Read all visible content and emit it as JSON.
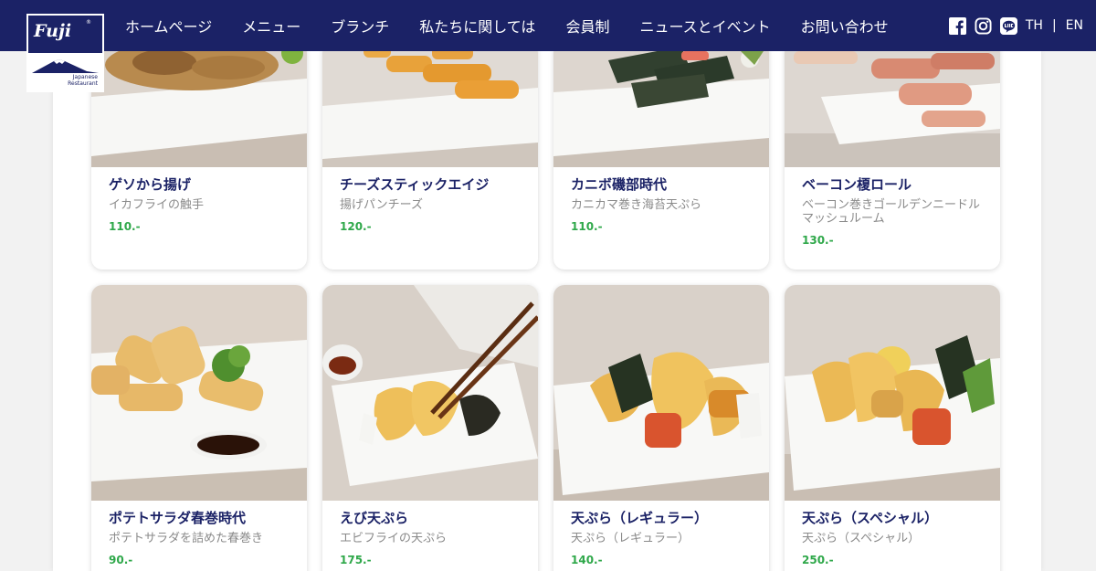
{
  "brand": {
    "logo_text": "Fuji",
    "logo_sub": "Japanese Restaurant",
    "navy": "#1b2266",
    "price_color": "#2fa84a"
  },
  "nav": {
    "items": [
      "ホームページ",
      "メニュー",
      "ブランチ",
      "私たちに関しては",
      "会員制",
      "ニュースとイベント",
      "お問い合わせ"
    ],
    "social": [
      "facebook-icon",
      "instagram-icon",
      "line-icon"
    ],
    "lang_th": "TH",
    "lang_sep": "|",
    "lang_en": "EN"
  },
  "menu": {
    "items": [
      {
        "title": "ゲソから揚げ",
        "desc": "イカフライの触手",
        "price": "110.-"
      },
      {
        "title": "チーズスティックエイジ",
        "desc": "揚げパンチーズ",
        "price": "120.-"
      },
      {
        "title": "カニボ磯部時代",
        "desc": "カニカマ巻き海苔天ぷら",
        "price": "110.-"
      },
      {
        "title": "ベーコン榎ロール",
        "desc": "ベーコン巻きゴールデンニードルマッシュルーム",
        "price": "130.-"
      },
      {
        "title": "ポテトサラダ春巻時代",
        "desc": "ポテトサラダを詰めた春巻き",
        "price": "90.-"
      },
      {
        "title": "えび天ぷら",
        "desc": "エビフライの天ぷら",
        "price": "175.-"
      },
      {
        "title": "天ぷら（レギュラー）",
        "desc": "天ぷら（レギュラー）",
        "price": "140.-"
      },
      {
        "title": "天ぷら（スペシャル）",
        "desc": "天ぷら（スペシャル）",
        "price": "250.-"
      }
    ]
  }
}
